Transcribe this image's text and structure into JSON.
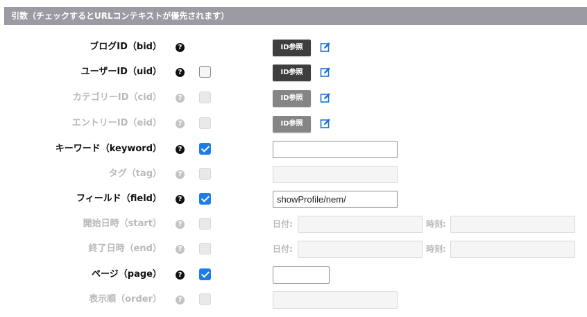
{
  "section": {
    "title": "引数（チェックするとURLコンテキストが優先されます）"
  },
  "help_glyph": "?",
  "rows": [
    {
      "label": "ブログID（bid）",
      "enabled": true,
      "checkbox": "none",
      "control": "id-ref",
      "button_label": "ID参照"
    },
    {
      "label": "ユーザーID（uid）",
      "enabled": true,
      "checkbox": "unchecked",
      "control": "id-ref",
      "button_label": "ID参照"
    },
    {
      "label": "カテゴリーID（cid）",
      "enabled": false,
      "checkbox": "disabled",
      "control": "id-ref",
      "button_label": "ID参照"
    },
    {
      "label": "エントリーID（eid）",
      "enabled": false,
      "checkbox": "disabled",
      "control": "id-ref",
      "button_label": "ID参照"
    },
    {
      "label": "キーワード（keyword）",
      "enabled": true,
      "checkbox": "checked",
      "control": "text",
      "value": ""
    },
    {
      "label": "タグ（tag）",
      "enabled": false,
      "checkbox": "disabled",
      "control": "text",
      "value": ""
    },
    {
      "label": "フィールド（field）",
      "enabled": true,
      "checkbox": "checked",
      "control": "text",
      "value": "showProfile/nem/"
    },
    {
      "label": "開始日時（start）",
      "enabled": false,
      "checkbox": "disabled",
      "control": "datetime",
      "date_label": "日付:",
      "time_label": "時刻:"
    },
    {
      "label": "終了日時（end）",
      "enabled": false,
      "checkbox": "disabled",
      "control": "datetime",
      "date_label": "日付:",
      "time_label": "時刻:"
    },
    {
      "label": "ページ（page）",
      "enabled": true,
      "checkbox": "checked",
      "control": "text-short",
      "value": ""
    },
    {
      "label": "表示順（order）",
      "enabled": false,
      "checkbox": "disabled",
      "control": "text",
      "value": ""
    }
  ],
  "colors": {
    "header_bg": "#9b9ba3",
    "checkbox_checked": "#1e7ce8",
    "button_dark": "#3e3e3e",
    "button_disabled": "#858585",
    "edit_icon": "#1a72d4",
    "disabled_text": "#b9b9b9"
  },
  "icons": {
    "help": "question-circle-icon",
    "edit": "pencil-square-icon"
  }
}
